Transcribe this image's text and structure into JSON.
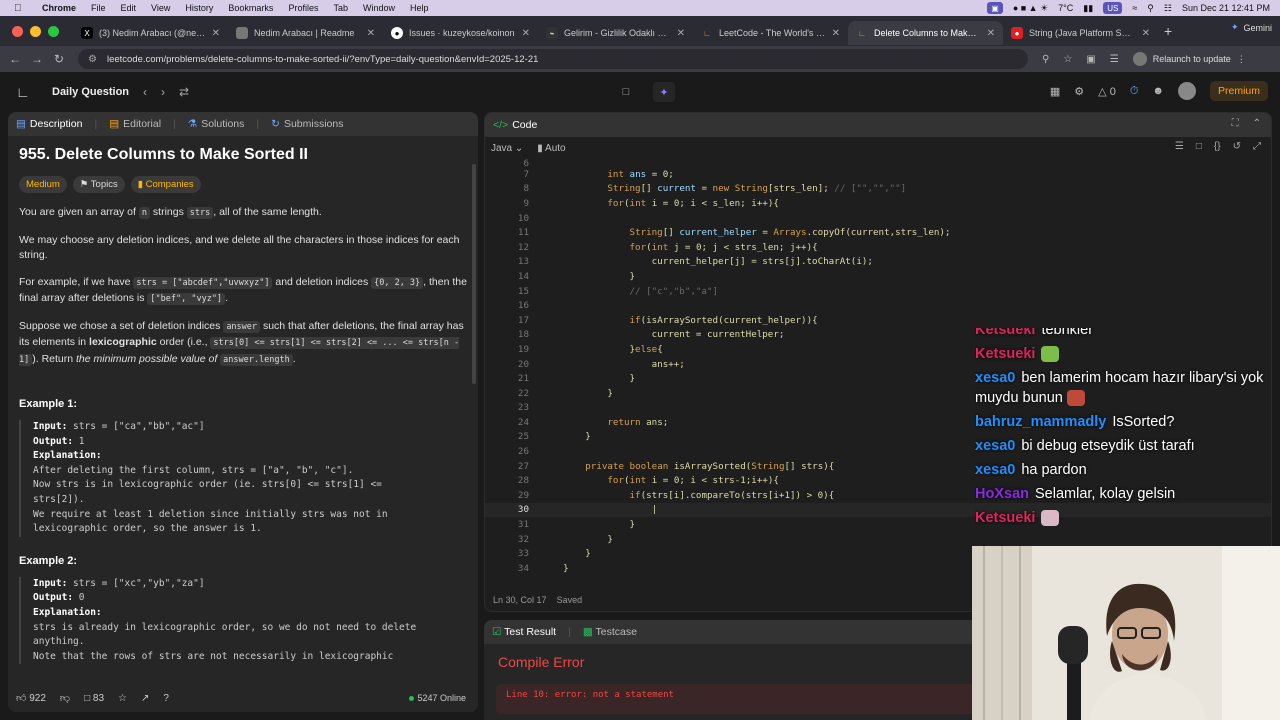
{
  "menubar": {
    "app": "Chrome",
    "items": [
      "File",
      "Edit",
      "View",
      "History",
      "Bookmarks",
      "Profiles",
      "Tab",
      "Window",
      "Help"
    ],
    "temp": "7°C",
    "kbd": "US",
    "datetime": "Sun Dec 21  12:41 PM"
  },
  "tabs": [
    {
      "title": "(3) Nedim Arabacı (@needim",
      "icon": "x-logo"
    },
    {
      "title": "Nedim Arabacı | Readme",
      "icon": "readme-logo"
    },
    {
      "title": "Issues · kuzeykose/koinon",
      "icon": "github-logo"
    },
    {
      "title": "Gelirim - Gizlilik Odaklı Finan",
      "icon": "gelirim-logo"
    },
    {
      "title": "LeetCode - The World's Leadi",
      "icon": "leetcode-logo"
    },
    {
      "title": "Delete Columns to Make Sorte",
      "icon": "leetcode-logo",
      "active": true
    },
    {
      "title": "String (Java Platform SE 8 )",
      "icon": "java-logo"
    }
  ],
  "gemini": "Gemini",
  "url": "leetcode.com/problems/delete-columns-to-make-sorted-ii/?envType=daily-question&envId=2025-12-21",
  "relaunch": "Relaunch to update",
  "lc": {
    "daily": "Daily Question",
    "streak": "0",
    "premium": "Premium"
  },
  "left": {
    "tabs": [
      "Description",
      "Editorial",
      "Solutions",
      "Submissions"
    ],
    "title": "955. Delete Columns to Make Sorted II",
    "badges": [
      "Medium",
      "Topics",
      "Companies"
    ],
    "likes": "922",
    "comments": "83",
    "online": "5247 Online"
  },
  "code": {
    "header": "Code",
    "language": "Java",
    "mode": "Auto",
    "status": "Ln 30, Col 17",
    "saved": "Saved"
  },
  "test": {
    "tabs": [
      "Test Result",
      "Testcase"
    ],
    "error_title": "Compile Error",
    "error_line": "Line 10: error: not a statement"
  },
  "chat": [
    {
      "user": "Ketsueki",
      "color": "#e0245e",
      "text": "tebrikler"
    },
    {
      "user": "Ketsueki",
      "color": "#e0245e",
      "text": ""
    },
    {
      "user": "xesa0",
      "color": "#1e90ff",
      "text": "ben lamerim hocam hazır libary'si yok muydu bunun"
    },
    {
      "user": "bahruz_mammadly",
      "color": "#1e90ff",
      "text": "IsSorted?"
    },
    {
      "user": "xesa0",
      "color": "#1e90ff",
      "text": "bi debug etseydik üst tarafı"
    },
    {
      "user": "xesa0",
      "color": "#1e90ff",
      "text": "ha pardon"
    },
    {
      "user": "HoXsan",
      "color": "#8a2be2",
      "text": "Selamlar, kolay gelsin"
    },
    {
      "user": "Ketsueki",
      "color": "#e0245e",
      "text": ""
    }
  ]
}
